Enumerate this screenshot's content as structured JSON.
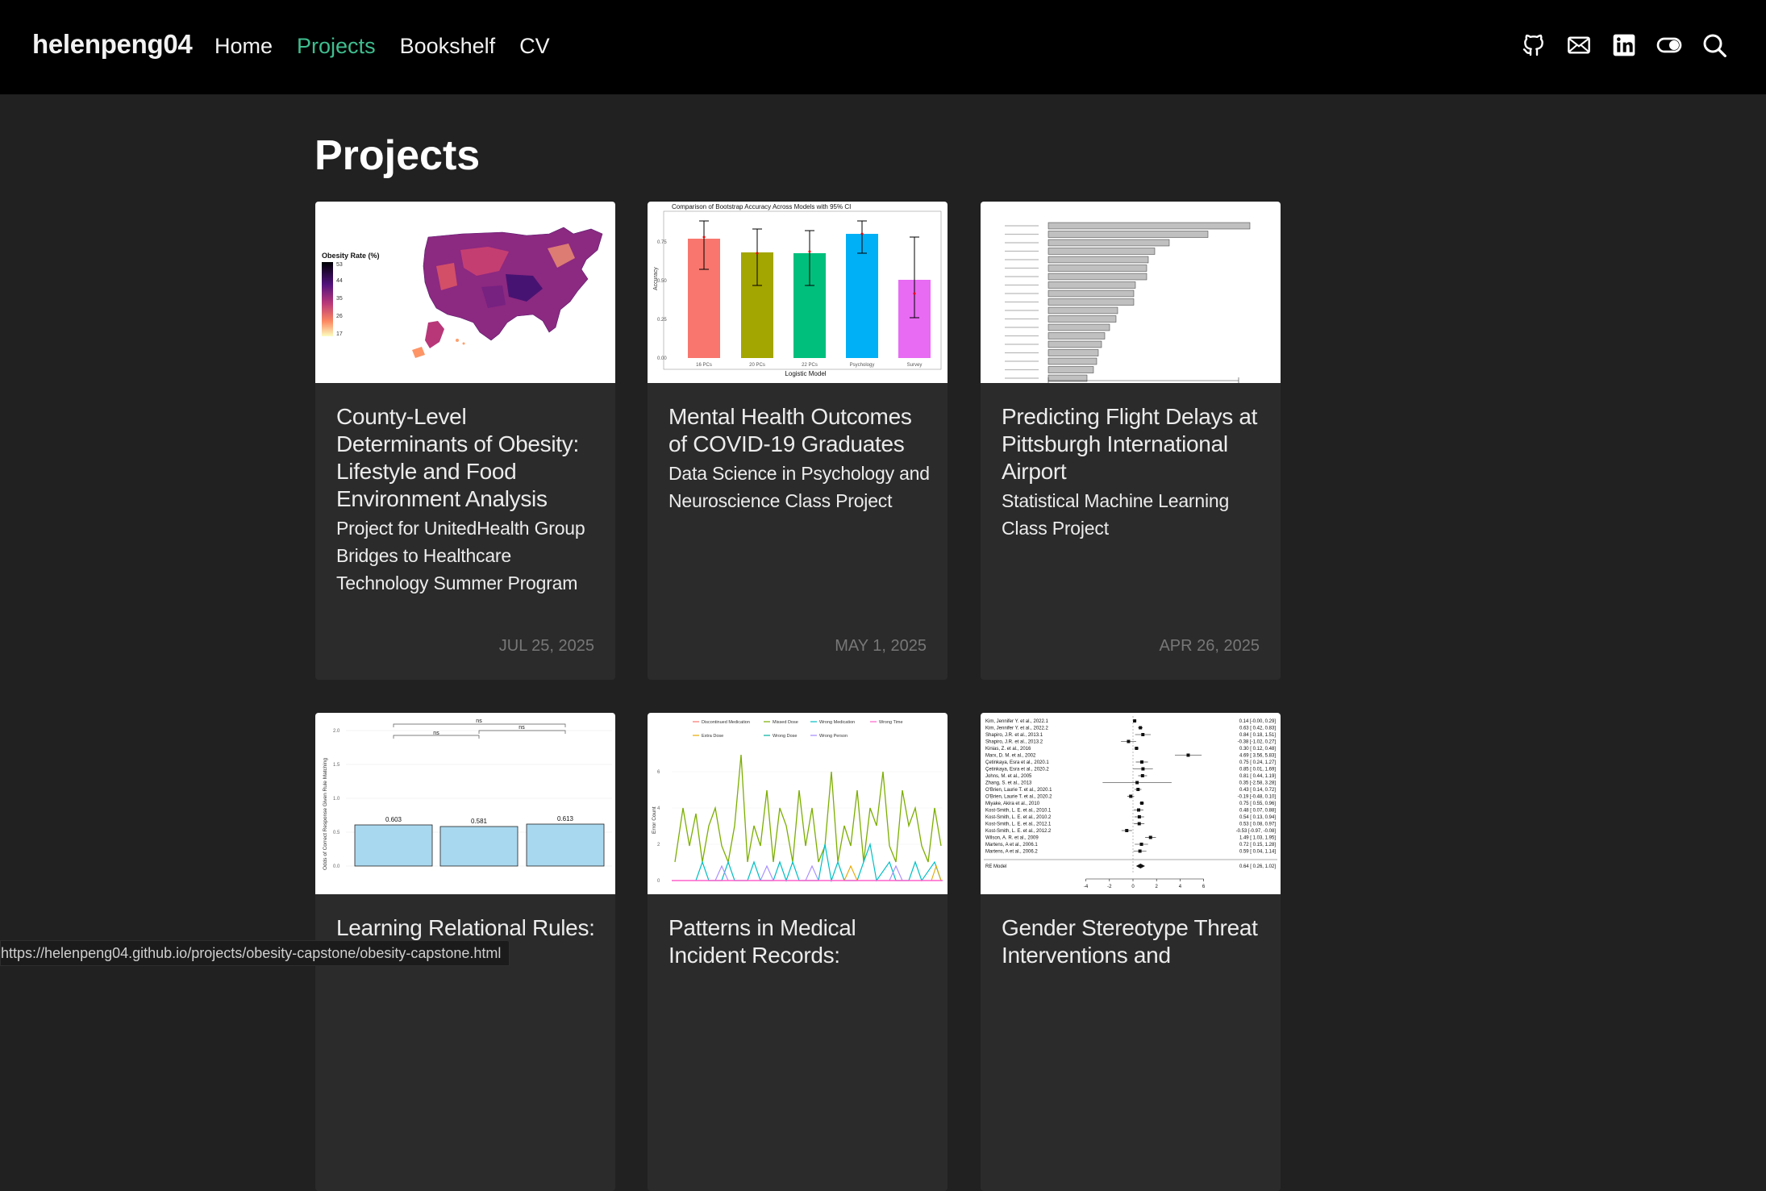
{
  "nav": {
    "site_title": "helenpeng04",
    "links": [
      {
        "label": "Home",
        "active": false
      },
      {
        "label": "Projects",
        "active": true
      },
      {
        "label": "Bookshelf",
        "active": false
      },
      {
        "label": "CV",
        "active": false
      }
    ],
    "icons": [
      "github-icon",
      "mail-icon",
      "linkedin-icon",
      "theme-toggle-icon",
      "search-icon"
    ],
    "active_color": "#3fbd8f"
  },
  "page_title": "Projects",
  "cards": [
    {
      "title": "County-Level Determinants of Obesity: Lifestyle and Food Environment Analysis",
      "subtitle": "Project for UnitedHealth Group Bridges to Healthcare Technology Summer Program",
      "date": "JUL 25, 2025",
      "thumb": {
        "legend_title": "Obesity Rate (%)",
        "legend_ticks": [
          "53",
          "44",
          "35",
          "26",
          "17"
        ]
      }
    },
    {
      "title": "Mental Health Outcomes of COVID-19 Graduates",
      "subtitle": "Data Science in Psychology and Neuroscience Class Project",
      "date": "MAY 1, 2025",
      "thumb": {
        "title": "Comparison of Bootstrap Accuracy Across Models with 95% CI",
        "xlabel": "Logistic Model",
        "ylabel": "Accuracy",
        "categories": [
          "16 PCs",
          "20 PCs",
          "22 PCs",
          "Psychology",
          "Survey"
        ],
        "yticks": [
          "0.75",
          "0.50",
          "0.25",
          "0.00"
        ],
        "colors": [
          "#f8766d",
          "#a3a500",
          "#00bf7d",
          "#00b0f6",
          "#e76bf3"
        ]
      }
    },
    {
      "title": "Predicting Flight Delays at Pittsburgh International Airport",
      "subtitle": "Statistical Machine Learning Class Project",
      "date": "APR 26, 2025",
      "thumb": {
        "bar_color": "#c0c0c0"
      }
    },
    {
      "title": "Learning Relational Rules:",
      "subtitle": "",
      "date": "",
      "thumb": {
        "ylabel": "Odds of Correct Response Given Rule Matching",
        "values": [
          "0.603",
          "0.581",
          "0.613"
        ],
        "sig_labels": [
          "ns",
          "ns",
          "ns"
        ],
        "yticks": [
          "2.0",
          "1.5",
          "1.0",
          "0.5",
          "0.0"
        ]
      }
    },
    {
      "title": "Patterns in Medical Incident Records:",
      "subtitle": "",
      "date": "",
      "thumb": {
        "ylabel": "Error Count",
        "legend": [
          "Discontinued Medication",
          "Missed Dose",
          "Wrong Medication",
          "Wrong Time",
          "Extra Dose",
          "Wrong Dose",
          "Wrong Person"
        ],
        "yticks": [
          "6",
          "4",
          "2",
          "0"
        ]
      }
    },
    {
      "title": "Gender Stereotype Threat Interventions and",
      "subtitle": "",
      "date": "",
      "thumb": {
        "studies": [
          {
            "name": "Kim, Jennifer Y. et al., 2022.1",
            "ci": "0.14 [-0.00, 0.29]"
          },
          {
            "name": "Kim, Jennifer Y. et al., 2022.2",
            "ci": "0.63 [ 0.42, 0.83]"
          },
          {
            "name": "Shapiro, J.R. et al., 2013.1",
            "ci": "0.84 [ 0.18, 1.51]"
          },
          {
            "name": "Shapiro, J.R. et al., 2013.2",
            "ci": "-0.38 [-1.02, 0.27]"
          },
          {
            "name": "Kinias, Z. et al., 2016",
            "ci": "0.30 [ 0.12, 0.48]"
          },
          {
            "name": "Marx, D. M. et al., 2002",
            "ci": "4.69 [ 3.56, 5.83]"
          },
          {
            "name": "Çetinkaya, Esra et al., 2020.1",
            "ci": "0.75 [ 0.24, 1.27]"
          },
          {
            "name": "Çetinkaya, Esra et al., 2020.2",
            "ci": "0.85 [ 0.01, 1.69]"
          },
          {
            "name": "Johns, M. et al., 2005",
            "ci": "0.81 [ 0.44, 1.19]"
          },
          {
            "name": "Zhang, S. et al., 2013",
            "ci": "0.35 [-2.58, 3.28]"
          },
          {
            "name": "O'Brien, Laurie T. et al., 2020.1",
            "ci": "0.43 [ 0.14, 0.72]"
          },
          {
            "name": "O'Brien, Laurie T. et al., 2020.2",
            "ci": "-0.19 [-0.48, 0.10]"
          },
          {
            "name": "Miyake, Akira et al., 2010",
            "ci": "0.75 [ 0.55, 0.96]"
          },
          {
            "name": "Kost-Smith, L. E. et al., 2010.1",
            "ci": "0.48 [ 0.07, 0.88]"
          },
          {
            "name": "Kost-Smith, L. E. et al., 2010.2",
            "ci": "0.54 [ 0.13, 0.94]"
          },
          {
            "name": "Kost-Smith, L. E. et al., 2012.1",
            "ci": "0.53 [ 0.08, 0.97]"
          },
          {
            "name": "Kost-Smith, L. E. et al., 2012.2",
            "ci": "-0.53 [-0.97, -0.08]"
          },
          {
            "name": "Wilson, A. R. et al., 2009",
            "ci": "1.49 [ 1.03, 1.95]"
          },
          {
            "name": "Martens, A et al., 2006.1",
            "ci": "0.72 [ 0.15, 1.28]"
          },
          {
            "name": "Martens, A et al., 2006.2",
            "ci": "0.59 [ 0.04, 1.14]"
          }
        ],
        "re_label": "RE Model",
        "re_ci": "0.64 [ 0.26, 1.02]",
        "xticks": [
          "-4",
          "-2",
          "0",
          "2",
          "4",
          "6"
        ]
      }
    }
  ],
  "status_url": "https://helenpeng04.github.io/projects/obesity-capstone/obesity-capstone.html"
}
